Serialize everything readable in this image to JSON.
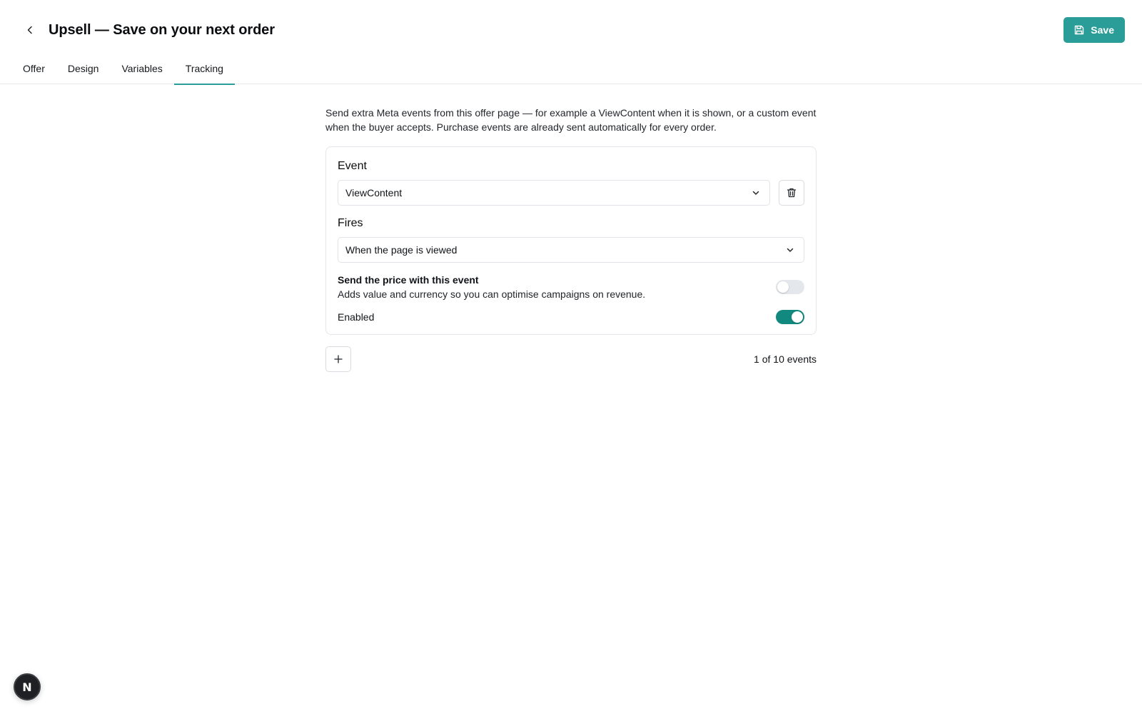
{
  "header": {
    "title": "Upsell — Save on your next order",
    "save_label": "Save",
    "back_icon": "chevron-left-icon",
    "save_icon": "floppy-disk-icon"
  },
  "tabs": [
    {
      "label": "Offer",
      "active": false
    },
    {
      "label": "Design",
      "active": false
    },
    {
      "label": "Variables",
      "active": false
    },
    {
      "label": "Tracking",
      "active": true
    }
  ],
  "tracking": {
    "intro": "Send extra Meta events from this offer page — for example a ViewContent when it is shown, or a custom event when the buyer accepts. Purchase events are already sent automatically for every order.",
    "events": [
      {
        "event_label": "Event",
        "event_value": "ViewContent",
        "fires_label": "Fires",
        "fires_value": "When the page is viewed",
        "price_title": "Send the price with this event",
        "price_desc": "Adds value and currency so you can optimise campaigns on revenue.",
        "price_enabled": false,
        "enabled_label": "Enabled",
        "enabled": true
      }
    ],
    "count_text": "1 of 10 events"
  },
  "dev_badge": {
    "letter": "N"
  },
  "colors": {
    "accent": "#2a9d98",
    "toggle_on": "#11897f",
    "toggle_off": "#e4e7eb",
    "border": "#e3e6ea"
  }
}
